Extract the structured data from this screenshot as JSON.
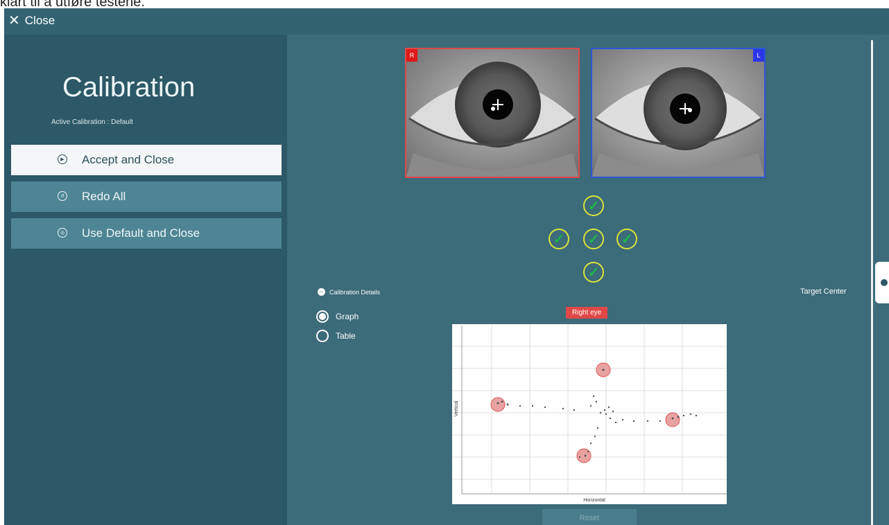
{
  "caption": "klart til å utføre testene.",
  "topbar": {
    "close_label": "Close"
  },
  "sidebar": {
    "title": "Calibration",
    "subtitle": "Active Calibration : Default",
    "buttons": [
      {
        "label": "Accept and Close",
        "icon": "play-circle-icon"
      },
      {
        "label": "Redo All",
        "icon": "redo-circle-icon"
      },
      {
        "label": "Use Default and Close",
        "icon": "default-circle-icon"
      }
    ]
  },
  "eyes": {
    "right": {
      "badge": "R",
      "color": "#e04848"
    },
    "left": {
      "badge": "L",
      "color": "#2c56d6"
    }
  },
  "calibration_points": [
    {
      "position": "top",
      "status": "ok"
    },
    {
      "position": "left",
      "status": "ok"
    },
    {
      "position": "center",
      "status": "ok"
    },
    {
      "position": "right",
      "status": "ok"
    },
    {
      "position": "bottom",
      "status": "ok"
    }
  ],
  "details": {
    "toggle_label": "Calibration Details",
    "options": [
      {
        "label": "Graph",
        "selected": true
      },
      {
        "label": "Table",
        "selected": false
      }
    ]
  },
  "target_label": "Target Center",
  "graph": {
    "tag": "Right eye",
    "xlabel": "Horizontal",
    "ylabel": "Vertical"
  },
  "reset_label": "Reset",
  "colors": {
    "accent_red": "#e04848",
    "accent_blue": "#2c56d6",
    "check_green": "#1fb64a",
    "ring_yellow": "#d8e43a",
    "bg": "#3c6b7a"
  }
}
